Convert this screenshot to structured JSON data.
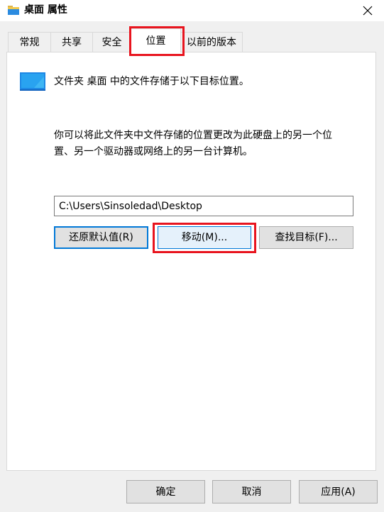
{
  "window": {
    "title": "桌面 属性",
    "title_icon": "folder-icon",
    "close_icon": "close-icon"
  },
  "tabs": [
    {
      "label": "常规",
      "active": false
    },
    {
      "label": "共享",
      "active": false
    },
    {
      "label": "安全",
      "active": false
    },
    {
      "label": "位置",
      "active": true
    },
    {
      "label": "以前的版本",
      "active": false
    }
  ],
  "location": {
    "description": "文件夹 桌面 中的文件存储于以下目标位置。",
    "info_line1": "你可以将此文件夹中文件存储的位置更改为此硬盘上的另一个位",
    "info_line2": "置、另一个驱动器或网络上的另一台计算机。",
    "path_value": "C:\\Users\\Sinsoledad\\Desktop",
    "restore_label": "还原默认值(R)",
    "move_label": "移动(M)...",
    "find_target_label": "查找目标(F)..."
  },
  "footer": {
    "ok_label": "确定",
    "cancel_label": "取消",
    "apply_label": "应用(A)"
  },
  "colors": {
    "highlight": "#e8141e",
    "accent": "#0078d7"
  }
}
